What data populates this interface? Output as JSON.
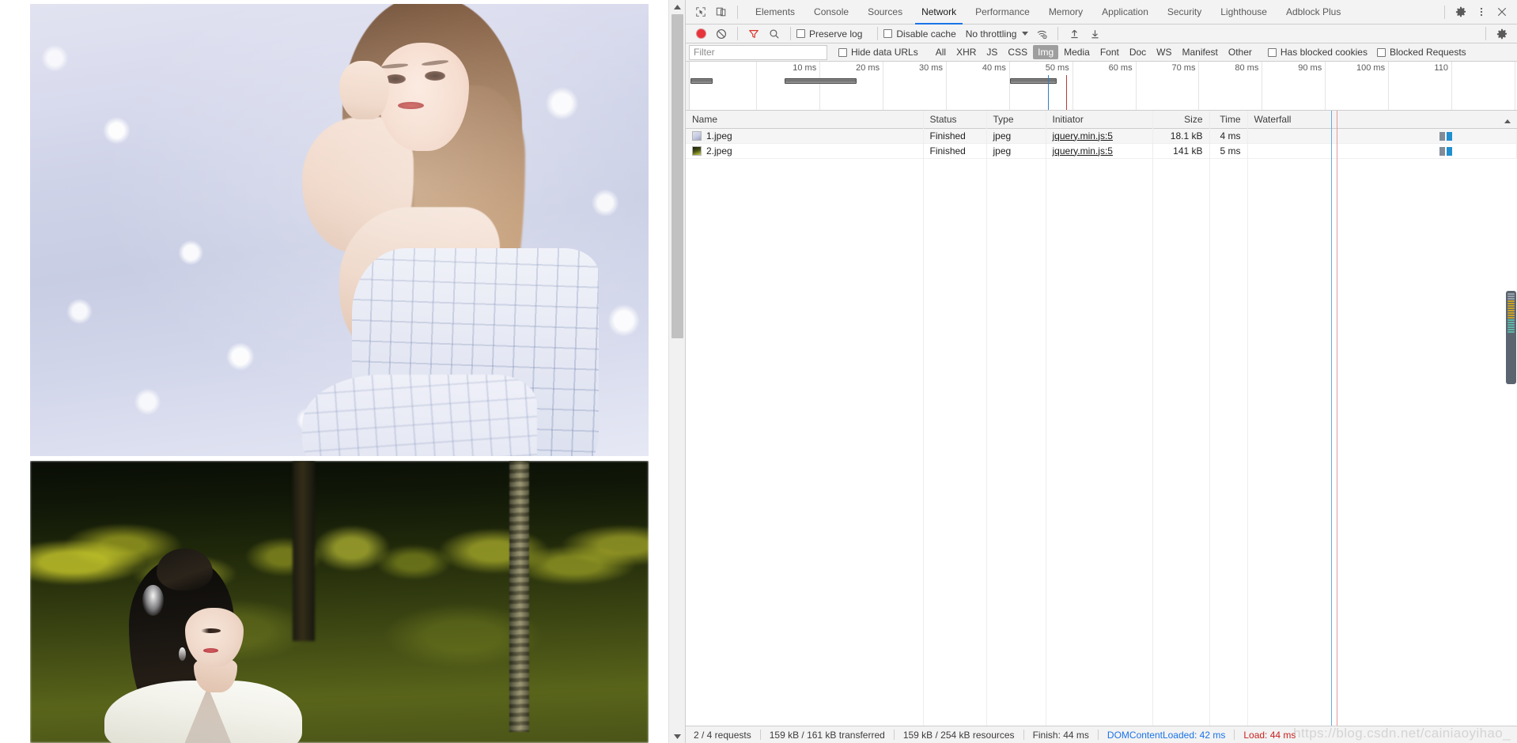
{
  "devtools": {
    "tabs": [
      {
        "label": "Elements",
        "active": false
      },
      {
        "label": "Console",
        "active": false
      },
      {
        "label": "Sources",
        "active": false
      },
      {
        "label": "Network",
        "active": true
      },
      {
        "label": "Performance",
        "active": false
      },
      {
        "label": "Memory",
        "active": false
      },
      {
        "label": "Application",
        "active": false
      },
      {
        "label": "Security",
        "active": false
      },
      {
        "label": "Lighthouse",
        "active": false
      },
      {
        "label": "Adblock Plus",
        "active": false
      }
    ],
    "tabbar_icons": {
      "inspect": "inspect-element-icon",
      "device": "device-toolbar-icon",
      "settings": "gear-icon",
      "more": "kebab-menu-icon",
      "close": "close-icon"
    },
    "toolbar": {
      "record_tooltip": "record-button",
      "clear_tooltip": "clear-button",
      "filter_tooltip": "filter-funnel-icon",
      "search_tooltip": "search-icon",
      "preserve_log_label": "Preserve log",
      "preserve_log_checked": false,
      "disable_cache_label": "Disable cache",
      "disable_cache_checked": false,
      "throttling_value": "No throttling",
      "wifi_icon": "network-conditions-icon",
      "import_icon": "import-har-icon",
      "export_icon": "export-har-icon",
      "settings_icon": "gear-icon"
    },
    "filterbar": {
      "filter_placeholder": "Filter",
      "filter_value": "",
      "hide_data_urls_label": "Hide data URLs",
      "hide_data_urls_checked": false,
      "types": [
        {
          "label": "All",
          "active": false
        },
        {
          "label": "XHR",
          "active": false
        },
        {
          "label": "JS",
          "active": false
        },
        {
          "label": "CSS",
          "active": false
        },
        {
          "label": "Img",
          "active": true
        },
        {
          "label": "Media",
          "active": false
        },
        {
          "label": "Font",
          "active": false
        },
        {
          "label": "Doc",
          "active": false
        },
        {
          "label": "WS",
          "active": false
        },
        {
          "label": "Manifest",
          "active": false
        },
        {
          "label": "Other",
          "active": false
        }
      ],
      "has_blocked_cookies_label": "Has blocked cookies",
      "has_blocked_cookies_checked": false,
      "blocked_requests_label": "Blocked Requests",
      "blocked_requests_checked": false
    },
    "overview": {
      "ticks": [
        "10 ms",
        "20 ms",
        "30 ms",
        "40 ms",
        "50 ms",
        "60 ms",
        "70 ms",
        "80 ms",
        "90 ms",
        "100 ms",
        "110"
      ],
      "bars": [
        {
          "left_pct": 0.6,
          "width_pct": 2.6
        },
        {
          "left_pct": 11.9,
          "width_pct": 8.7
        },
        {
          "left_pct": 39.0,
          "width_pct": 5.6
        }
      ],
      "dcl_pct": 43.6,
      "load_pct": 45.8
    },
    "columns": [
      {
        "label": "Name",
        "align": "left"
      },
      {
        "label": "Status",
        "align": "left"
      },
      {
        "label": "Type",
        "align": "left"
      },
      {
        "label": "Initiator",
        "align": "left"
      },
      {
        "label": "Size",
        "align": "right"
      },
      {
        "label": "Time",
        "align": "right"
      },
      {
        "label": "Waterfall",
        "align": "left"
      }
    ],
    "sort_indicator": "sort-ascending-caret",
    "rows": [
      {
        "name": "1.jpeg",
        "thumb": "jpeg-thumbnail-1",
        "status": "Finished",
        "type": "jpeg",
        "initiator": "jquery.min.js:5",
        "size": "18.1 kB",
        "time": "4 ms",
        "wf_gray_pct": 71.4,
        "wf_blue_pct": 74.2
      },
      {
        "name": "2.jpeg",
        "thumb": "jpeg-thumbnail-2",
        "status": "Finished",
        "type": "jpeg",
        "initiator": "jquery.min.js:5",
        "size": "141 kB",
        "time": "5 ms",
        "wf_gray_pct": 71.4,
        "wf_blue_pct": 74.2
      }
    ],
    "statusbar": {
      "requests": "2 / 4 requests",
      "transferred": "159 kB / 161 kB transferred",
      "resources": "159 kB / 254 kB resources",
      "finish": "Finish: 44 ms",
      "dom_content_loaded": "DOMContentLoaded: 42 ms",
      "load": "Load: 44 ms"
    }
  },
  "page": {
    "images": [
      {
        "alt": "young woman by sparkling water",
        "file": "1.jpeg"
      },
      {
        "alt": "woman in white robe in green park",
        "file": "2.jpeg"
      }
    ],
    "scrollbar": {
      "up_arrow": "scroll-up-arrow",
      "down_arrow": "scroll-down-arrow"
    }
  },
  "watermark": "https://blog.csdn.net/cainiaoyihao_",
  "colors": {
    "accent_blue": "#1a73e8",
    "record_red": "#e8333a",
    "load_red": "#c5221f",
    "chip_active_bg": "#9e9e9e",
    "toolbar_bg": "#f3f3f3",
    "border": "#cdcdcd"
  }
}
